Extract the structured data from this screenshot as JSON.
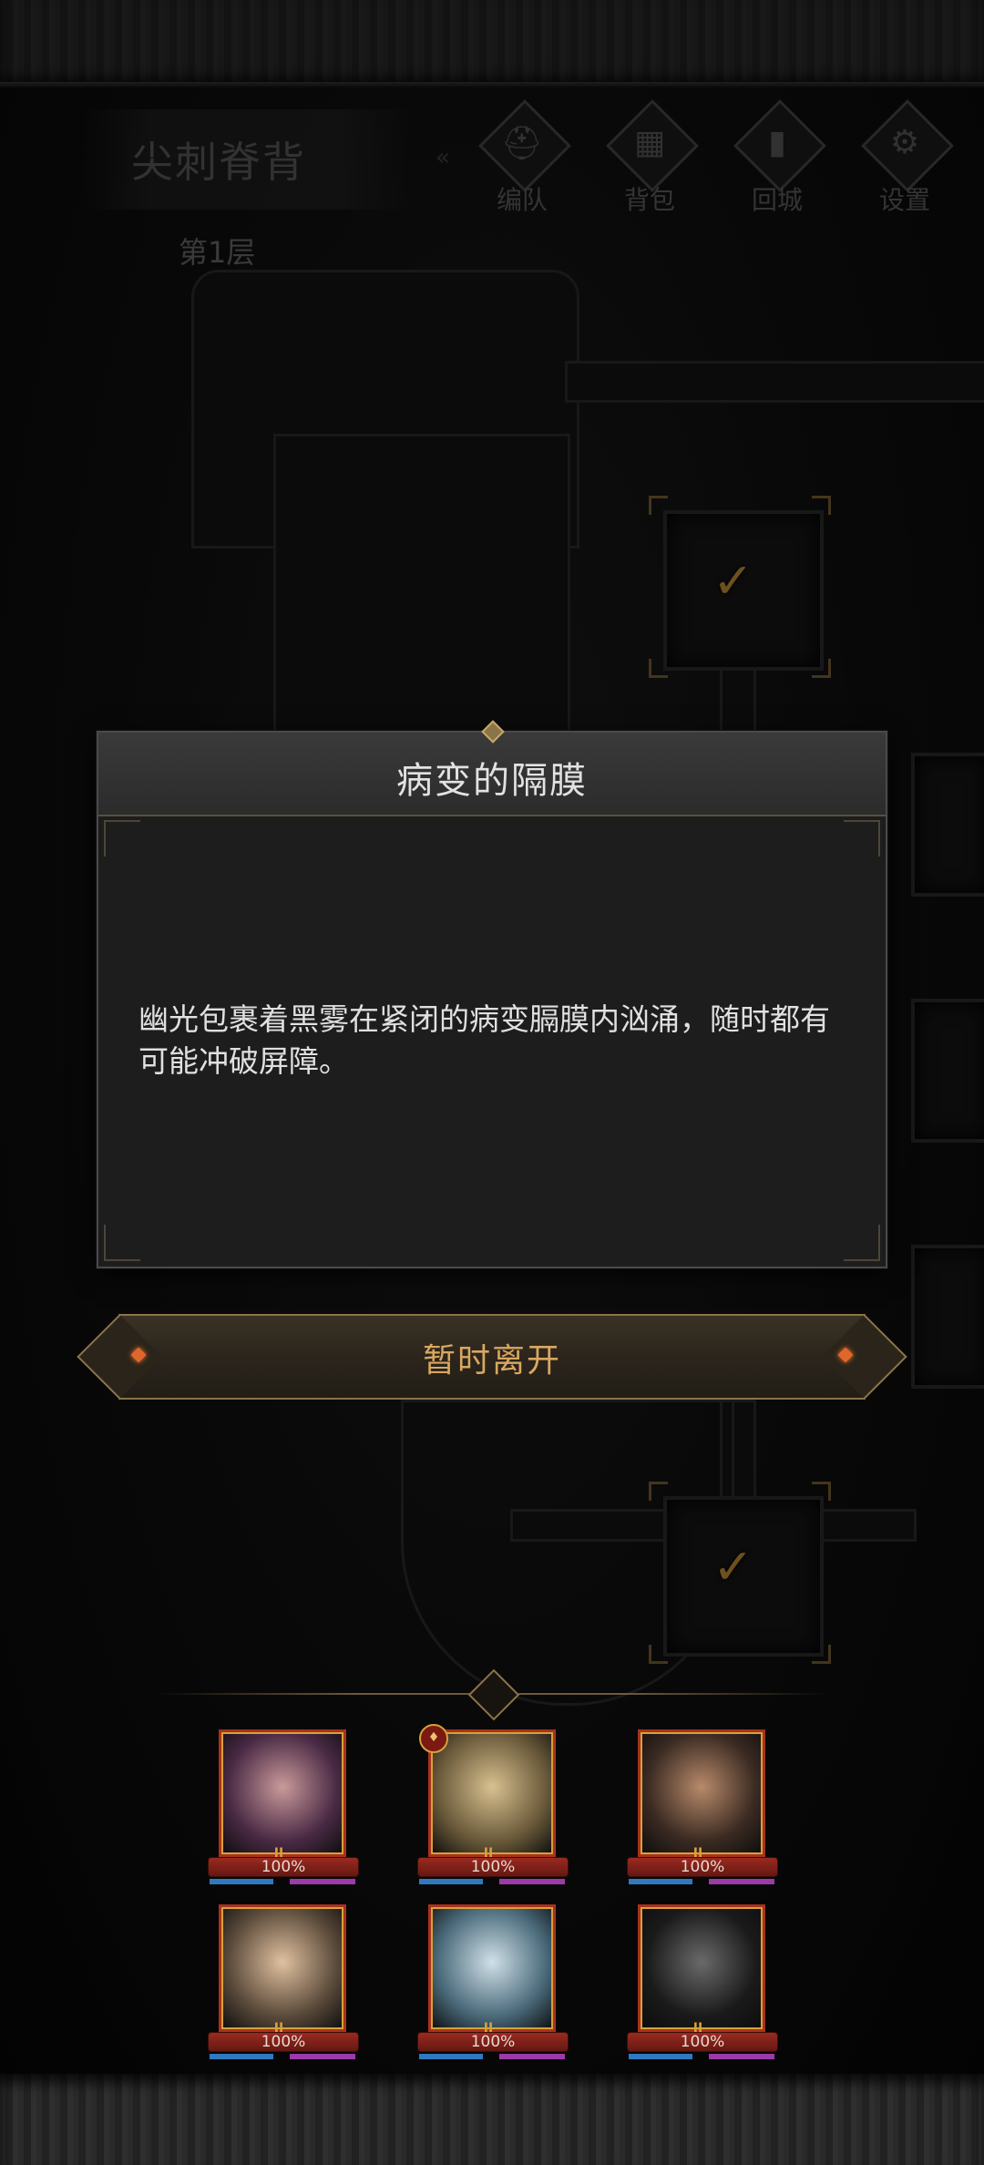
{
  "hud": {
    "dungeon_name": "尖刺脊背",
    "floor": "第1层",
    "buttons": [
      {
        "label": "编队",
        "icon": "helmet-icon"
      },
      {
        "label": "背包",
        "icon": "backpack-icon"
      },
      {
        "label": "回城",
        "icon": "door-icon"
      },
      {
        "label": "设置",
        "icon": "gear-icon"
      }
    ]
  },
  "map": {
    "cleared_room_icon": "checkmark-icon",
    "check_glyph": "✓"
  },
  "dialog": {
    "title": "病变的隔膜",
    "body": "幽光包裹着黑雾在紧闭的病变膈膜内汹涌，随时都有可能冲破屏障。",
    "leave_button": "暂时离开"
  },
  "party": {
    "heroes": [
      {
        "hp": "100%",
        "rank": "II",
        "portrait_colors": [
          "#4a2a45",
          "#c99a9a"
        ]
      },
      {
        "hp": "100%",
        "rank": "II",
        "portrait_colors": [
          "#6a5a3a",
          "#d8c090"
        ],
        "badge": "♦"
      },
      {
        "hp": "100%",
        "rank": "II",
        "portrait_colors": [
          "#3a2a22",
          "#b88a6a"
        ]
      },
      {
        "hp": "100%",
        "rank": "II",
        "portrait_colors": [
          "#5a4a3a",
          "#e0c0a0"
        ]
      },
      {
        "hp": "100%",
        "rank": "II",
        "portrait_colors": [
          "#4a6a7a",
          "#d0e0e8"
        ]
      },
      {
        "hp": "100%",
        "rank": "II",
        "portrait_colors": [
          "#1a1a1a",
          "#6a6a6a"
        ]
      }
    ]
  },
  "colors": {
    "accent_gold": "#d9a760",
    "hp_red": "#9a2a20",
    "mana_blue": "#2f79c0",
    "energy_purple": "#9b3aa8"
  }
}
